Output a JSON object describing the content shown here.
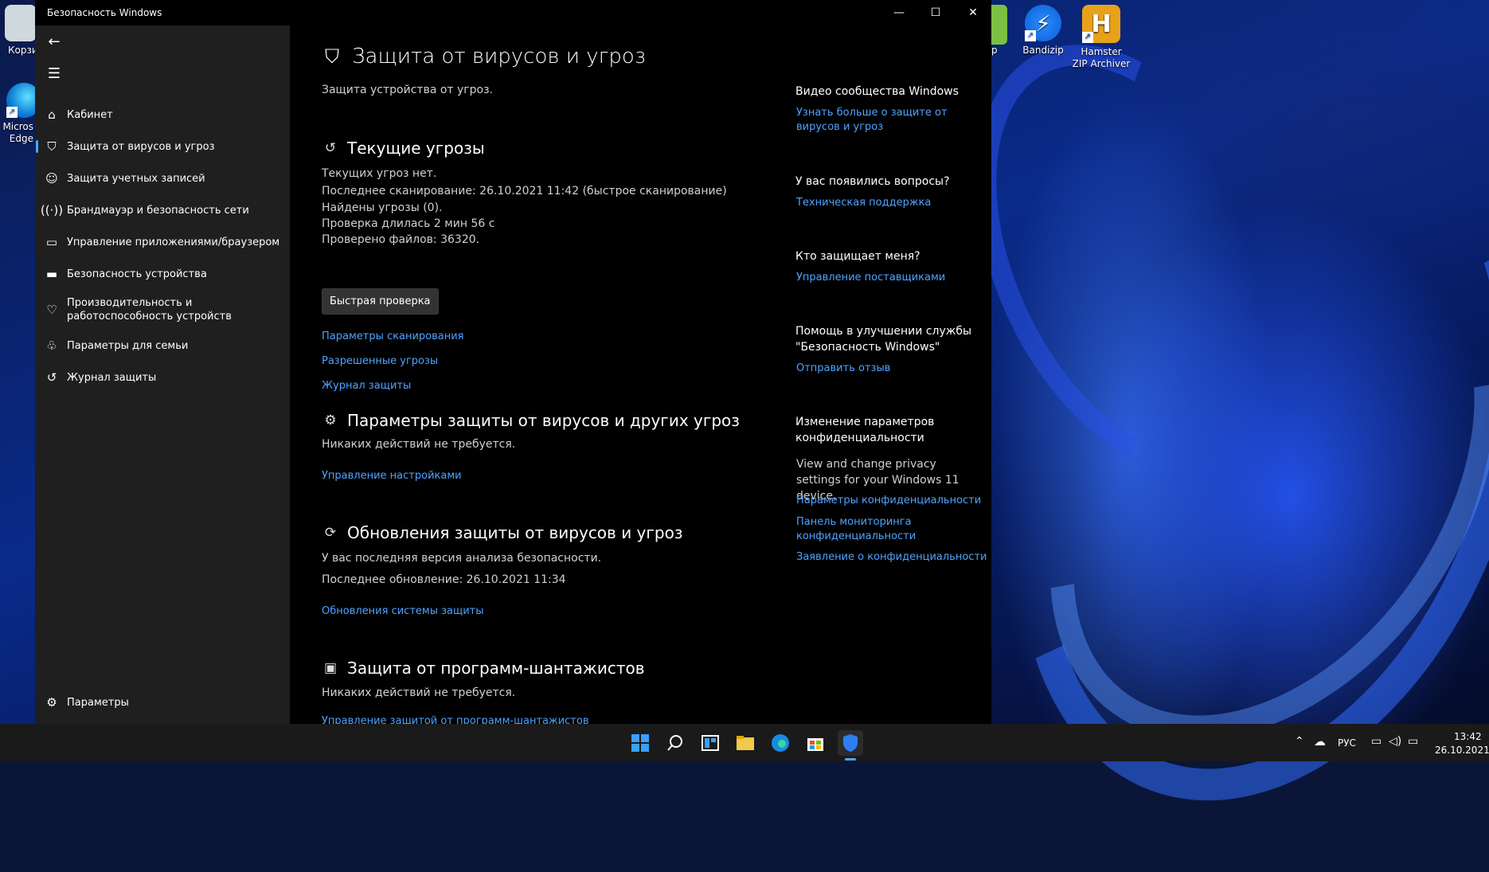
{
  "desktop": {
    "icons": [
      {
        "label": "Корзи",
        "icon": "recycle-bin-icon"
      },
      {
        "label": "Micros Edge",
        "icon": "edge-icon"
      },
      {
        "label": "p",
        "icon": "app-icon"
      },
      {
        "label": "Bandizip",
        "icon": "bandizip-icon"
      },
      {
        "label": "Hamster ZIP Archiver",
        "icon": "hamster-zip-icon"
      }
    ]
  },
  "window": {
    "title": "Безопасность Windows",
    "controls": {
      "minimize": "—",
      "maximize": "☐",
      "close": "✕"
    }
  },
  "sidebar": {
    "back_icon": "back-arrow-icon",
    "menu_icon": "hamburger-icon",
    "items": [
      {
        "label": "Кабинет",
        "icon": "home-icon"
      },
      {
        "label": "Защита от вирусов и угроз",
        "icon": "shield-icon",
        "active": true
      },
      {
        "label": "Защита учетных записей",
        "icon": "person-icon"
      },
      {
        "label": "Брандмауэр и безопасность сети",
        "icon": "wifi-icon"
      },
      {
        "label": "Управление приложениями/браузером",
        "icon": "app-browser-icon"
      },
      {
        "label": "Безопасность устройства",
        "icon": "laptop-icon"
      },
      {
        "label": "Производительность и работоспособность устройств",
        "icon": "heart-icon"
      },
      {
        "label": "Параметры для семьи",
        "icon": "family-icon"
      },
      {
        "label": "Журнал защиты",
        "icon": "history-icon"
      }
    ],
    "settings": {
      "label": "Параметры",
      "icon": "gear-icon"
    }
  },
  "main": {
    "title": "Защита от вирусов и угроз",
    "subtitle": "Защита устройства от угроз.",
    "current_threats": {
      "heading": "Текущие угрозы",
      "lines": [
        "Текущих угроз нет.",
        "Последнее сканирование: 26.10.2021 11:42 (быстрое сканирование)",
        "Найдены угрозы (0).",
        "Проверка длилась 2 мин 56 с",
        "Проверено файлов: 36320."
      ],
      "button": "Быстрая проверка",
      "links": [
        "Параметры сканирования",
        "Разрешенные угрозы",
        "Журнал защиты"
      ]
    },
    "protection_settings": {
      "heading": "Параметры защиты от вирусов и других угроз",
      "text": "Никаких действий не требуется.",
      "link": "Управление настройками"
    },
    "updates": {
      "heading": "Обновления защиты от вирусов и угроз",
      "lines": [
        "У вас последняя версия анализа безопасности.",
        "Последнее обновление: 26.10.2021 11:34"
      ],
      "link": "Обновления системы защиты"
    },
    "ransomware": {
      "heading": "Защита от программ-шантажистов",
      "text": "Никаких действий не требуется.",
      "link": "Управление защитой от программ-шантажистов"
    }
  },
  "right": {
    "video": {
      "heading": "Видео сообщества Windows",
      "link": "Узнать больше о защите от вирусов и угроз"
    },
    "questions": {
      "heading": "У вас появились вопросы?",
      "link": "Техническая поддержка"
    },
    "who": {
      "heading": "Кто защищает меня?",
      "link": "Управление поставщиками"
    },
    "help": {
      "heading": "Помощь в улучшении службы \"Безопасность Windows\"",
      "link": "Отправить отзыв"
    },
    "privacy": {
      "heading": "Изменение параметров конфиденциальности",
      "text": "View and change privacy settings for your Windows 11 device.",
      "links": [
        "Параметры конфиденциальности",
        "Панель мониторинга конфиденциальности",
        "Заявление о конфиденциальности"
      ]
    }
  },
  "taskbar": {
    "apps": [
      "start-icon",
      "search-icon",
      "widgets-icon",
      "file-explorer-icon",
      "edge-icon",
      "store-icon",
      "windows-security-icon"
    ],
    "tray": {
      "language": "РУС",
      "time": "13:42",
      "date": "26.10.2021"
    }
  }
}
